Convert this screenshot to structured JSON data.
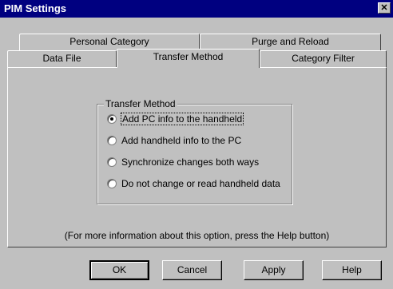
{
  "window": {
    "title": "PIM Settings",
    "close_glyph": "✕"
  },
  "tabs_row_back": [
    {
      "label": "Personal Category"
    },
    {
      "label": "Purge and Reload"
    }
  ],
  "tabs_row_front": [
    {
      "label": "Data File"
    },
    {
      "label": "Transfer Method",
      "active": true
    },
    {
      "label": "Category Filter"
    }
  ],
  "transfer_method": {
    "group_label": "Transfer Method",
    "options": [
      {
        "label": "Add PC info to the handheld",
        "selected": true
      },
      {
        "label": "Add handheld info to the PC",
        "selected": false
      },
      {
        "label": "Synchronize changes both ways",
        "selected": false
      },
      {
        "label": "Do not change or read handheld data",
        "selected": false
      }
    ]
  },
  "help_text": "(For more information about this option, press the Help button)",
  "buttons": {
    "ok": "OK",
    "cancel": "Cancel",
    "apply": "Apply",
    "help": "Help"
  }
}
